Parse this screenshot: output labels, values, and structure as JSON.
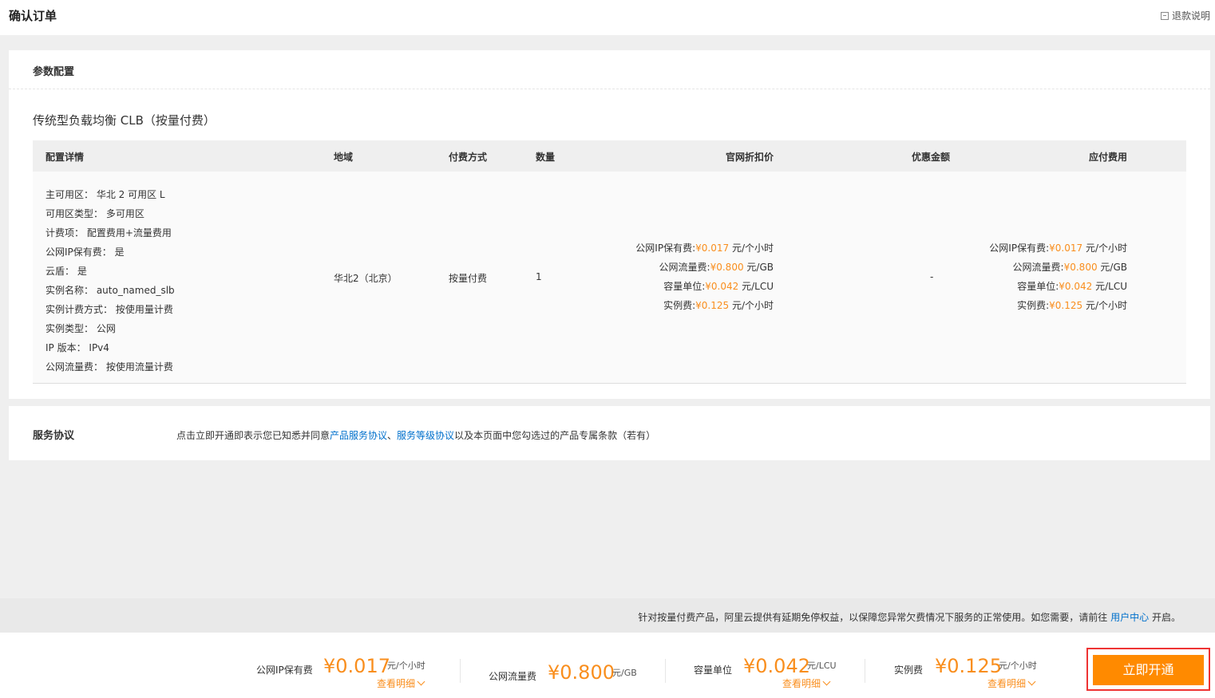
{
  "header": {
    "title": "确认订单",
    "refund_label": "退款说明"
  },
  "params": {
    "section_title": "参数配置",
    "product_title": "传统型负载均衡 CLB（按量付费）",
    "columns": [
      "配置详情",
      "地域",
      "付费方式",
      "数量",
      "官网折扣价",
      "优惠金额",
      "应付费用"
    ],
    "details": [
      "主可用区： 华北 2 可用区 L",
      "可用区类型： 多可用区",
      "计费项： 配置费用+流量费用",
      "公网IP保有费： 是",
      "云盾： 是",
      "实例名称： auto_named_slb",
      "实例计费方式： 按使用量计费",
      "实例类型： 公网",
      "IP 版本： IPv4",
      "公网流量费： 按使用流量计费"
    ],
    "region": "华北2（北京）",
    "pay_method": "按量付费",
    "quantity": "1",
    "discount": "-",
    "prices": [
      {
        "label": "公网IP保有费:",
        "amount": "¥0.017",
        "unit": "元/个小时"
      },
      {
        "label": "公网流量费:",
        "amount": "¥0.800",
        "unit": "元/GB"
      },
      {
        "label": "容量单位:",
        "amount": "¥0.042",
        "unit": "元/LCU"
      },
      {
        "label": "实例费:",
        "amount": "¥0.125",
        "unit": "元/个小时"
      }
    ]
  },
  "service": {
    "title": "服务协议",
    "text_before": "点击立即开通即表示您已知悉并同意",
    "link1": "产品服务协议",
    "sep": "、",
    "link2": "服务等级协议",
    "text_after": "以及本页面中您勾选过的产品专属条款（若有）"
  },
  "notice": {
    "text": "针对按量付费产品，阿里云提供有延期免停权益，以保障您异常欠费情况下服务的正常使用。如您需要，请前往",
    "link": "用户中心",
    "suffix": "开启。"
  },
  "footer": {
    "fees": [
      {
        "label": "公网IP保有费",
        "amount": "¥0.017",
        "unit": "元/个小时",
        "detail": "查看明细"
      },
      {
        "label": "公网流量费",
        "amount": "¥0.800",
        "unit": "元/GB",
        "detail": ""
      },
      {
        "label": "容量单位",
        "amount": "¥0.042",
        "unit": "元/LCU",
        "detail": "查看明细"
      },
      {
        "label": "实例费",
        "amount": "¥0.125",
        "unit": "元/个小时",
        "detail": "查看明细"
      }
    ],
    "open_button": "立即开通"
  },
  "colors": {
    "accent": "#ff8a00",
    "price": "#f98e1d",
    "link": "#0070cc",
    "highlight_border": "#e33"
  }
}
